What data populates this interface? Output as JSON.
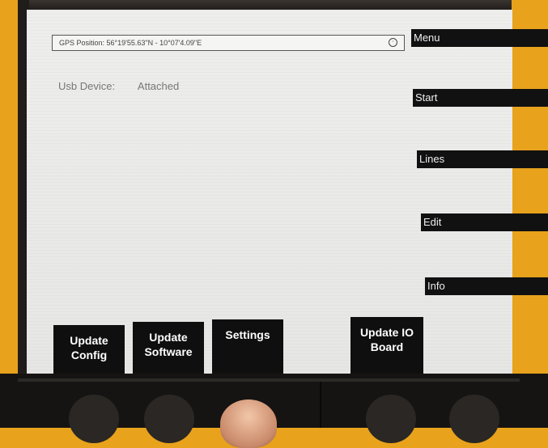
{
  "status": {
    "gps_text": "GPS Position: 56°19'55.63\"N - 10°07'4.09\"E",
    "usb_label": "Usb Device:",
    "usb_value": "Attached"
  },
  "side_menu": {
    "menu": "Menu",
    "start": "Start",
    "lines": "Lines",
    "edit": "Edit",
    "info": "Info"
  },
  "bottom_buttons": {
    "update_config_1": "Update",
    "update_config_2": "Config",
    "update_software_1": "Update",
    "update_software_2": "Software",
    "settings": "Settings",
    "update_io_1": "Update IO",
    "update_io_2": "Board"
  }
}
